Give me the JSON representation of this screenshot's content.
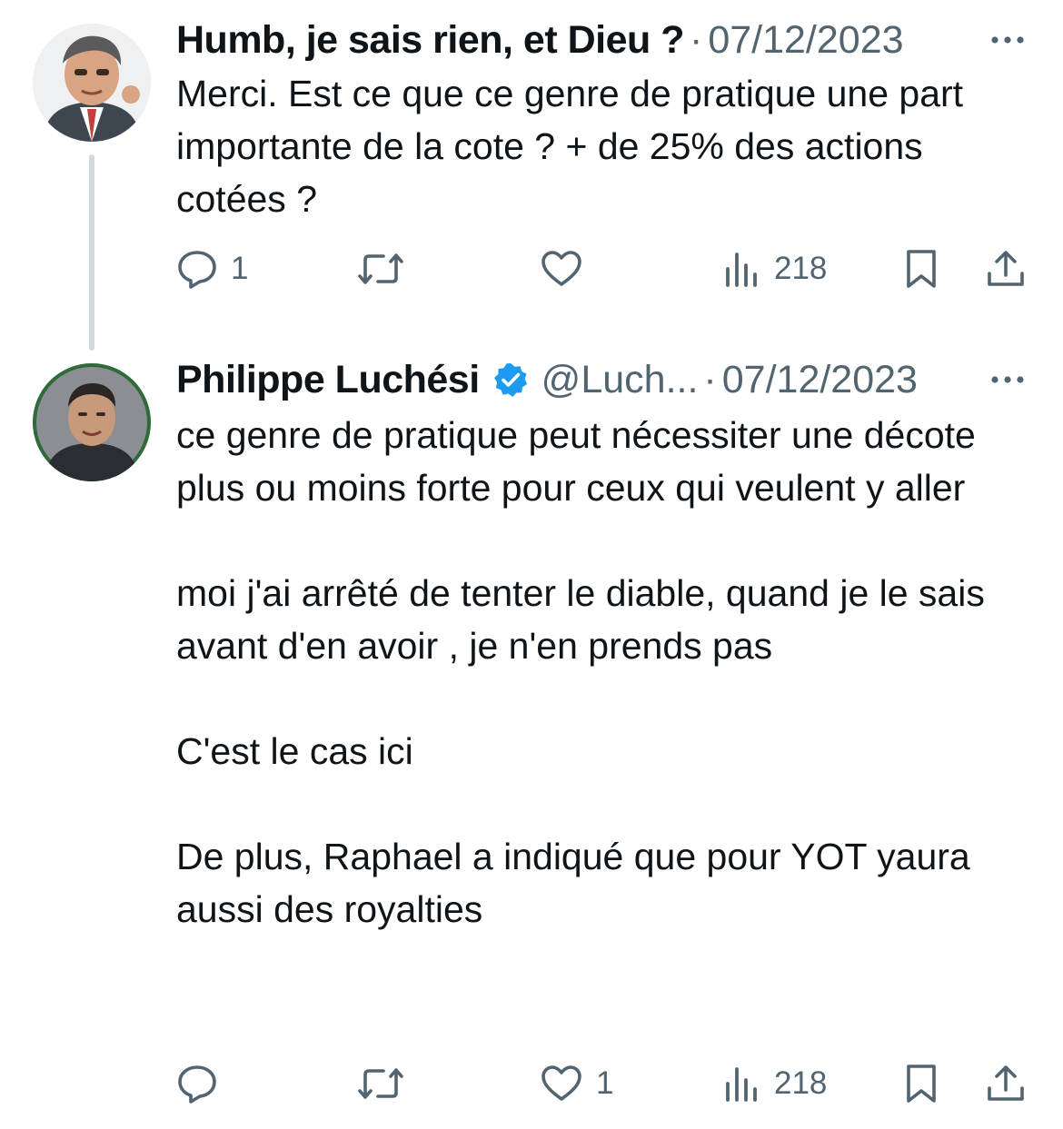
{
  "tweets": [
    {
      "author": {
        "name": "Humb, je sais rien, et Dieu ?",
        "handle": "",
        "verified": false
      },
      "separator": "·",
      "date": "07/12/2023",
      "text": "Merci. Est ce que ce genre de pratique une part importante de la cote ? + de 25% des actions cotées ?",
      "actions": {
        "reply_count": "1",
        "retweet_count": "",
        "like_count": "",
        "views_count": "218"
      }
    },
    {
      "author": {
        "name": "Philippe Luchési",
        "handle": "@Luch...",
        "verified": true
      },
      "separator": "·",
      "date": "07/12/2023",
      "text": "ce genre de pratique peut nécessiter une décote\nplus ou moins forte pour ceux qui veulent y aller\n\nmoi j'ai arrêté de tenter le diable, quand je le sais avant d'en avoir , je n'en prends pas\n\nC'est le cas ici\n\nDe plus, Raphael a indiqué que pour YOT yaura aussi des royalties",
      "actions": {
        "reply_count": "",
        "retweet_count": "",
        "like_count": "1",
        "views_count": "218"
      }
    }
  ],
  "icons": {
    "reply": "reply-icon",
    "retweet": "retweet-icon",
    "like": "heart-icon",
    "views": "views-icon",
    "bookmark": "bookmark-icon",
    "share": "share-icon",
    "more": "more-icon",
    "verified": "verified-badge-icon"
  },
  "colors": {
    "text": "#0f1419",
    "secondary": "#536471",
    "verified": "#1d9bf0",
    "thread_line": "#cfd9de"
  }
}
